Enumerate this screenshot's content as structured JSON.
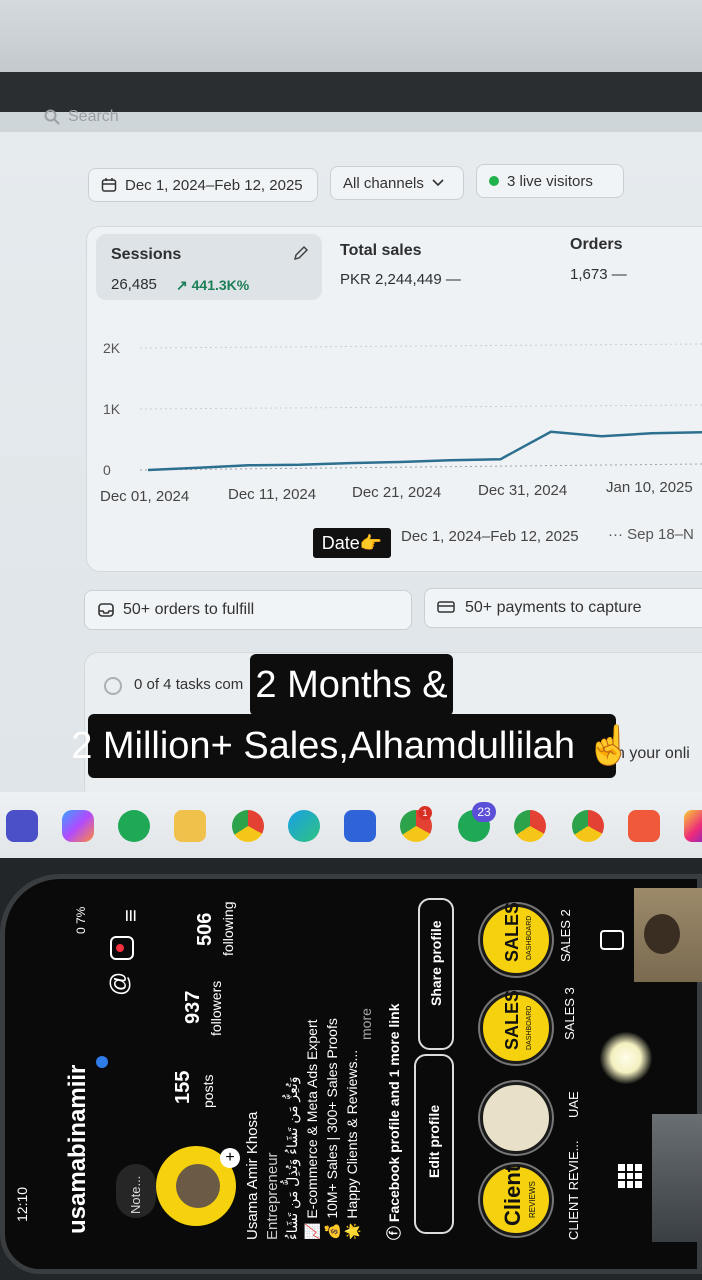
{
  "colors": {
    "accent_green": "#1c7f57",
    "live_dot": "#22b24c",
    "highlight": "#f5d10e"
  },
  "dashboard": {
    "search_label": "Search",
    "date_range": "Dec 1, 2024–Feb 12, 2025",
    "channel_filter": "All channels",
    "live_visitors": "3 live visitors",
    "metrics": [
      {
        "label": "Sessions",
        "value": "26,485",
        "trend": "↗ 441.3K%"
      },
      {
        "label": "Total sales",
        "value": "PKR 2,244,449 —"
      },
      {
        "label": "Orders",
        "value": "1,673 —"
      }
    ],
    "chart_data": {
      "type": "line",
      "x": [
        "Dec 01, 2024",
        "Dec 11, 2024",
        "Dec 21, 2024",
        "Dec 31, 2024",
        "Jan 10, 2025"
      ],
      "y_ticks": [
        "2K",
        "1K",
        "0"
      ],
      "series": [
        {
          "values": [
            0,
            30,
            60,
            60,
            80,
            90,
            110,
            120,
            560,
            480,
            520,
            530
          ]
        }
      ]
    },
    "legend": {
      "date_badge": "Date👉",
      "primary_range": "Dec 1, 2024–Feb 12, 2025",
      "compare_range": "··· Sep 18–N"
    },
    "fulfill": "50+ orders to fulfill",
    "payments": "50+ payments to capture",
    "tasks": "0 of 4 tasks com",
    "tasks_tail": "n your onli"
  },
  "captions": {
    "line1": "2 Months &",
    "line2": "2 Million+ Sales,Alhamdullilah ☝️"
  },
  "taskbar": {
    "whatsapp_badge": "23",
    "chrome_badge": "1"
  },
  "instagram": {
    "time": "12:10",
    "battery": "0 7%",
    "username": "usamabinamiir",
    "note": "Note...",
    "posts_count": "155",
    "posts_label": "posts",
    "followers_count": "937",
    "followers_label": "followers",
    "following_count": "506",
    "following_label": "following",
    "name": "Usama Amir Khosa",
    "category": "Entrepreneur",
    "bio": [
      "وَتُعِزُّ مَن تَشَاءُ وَتُذِلُّ مَن تَشَاءُ",
      "📈 E-commerce & Meta Ads Expert",
      "💰 10M+ Sales | 300+ Sales Proofs",
      "🌟 Happy Clients & Reviews...",
      "more",
      "ⓕ Facebook profile and 1 more link"
    ],
    "edit_profile": "Edit profile",
    "share_profile": "Share profile",
    "highlights": [
      {
        "label": "CLIENT REVIE...",
        "cover": "Client",
        "sub": "REVIEWS"
      },
      {
        "label": "UAE",
        "cover": "",
        "sub": ""
      },
      {
        "label": "SALES 3",
        "cover": "SALES",
        "sub": "DASHBOARD"
      },
      {
        "label": "SALES 2",
        "cover": "SALES",
        "sub": "DASHBOARD"
      }
    ]
  }
}
